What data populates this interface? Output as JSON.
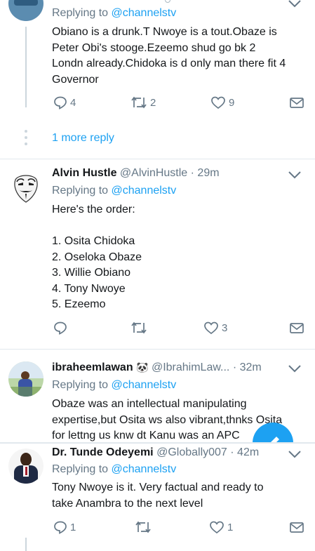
{
  "replying_prefix": "Replying to",
  "tweet1": {
    "replying_to": "@channelstv",
    "text": "Obiano is a drunk.T Nwoye is a tout.Obaze is\nPeter Obi's stooge.Ezeemo shud go bk 2\nLondn already.Chidoka is d only man there fit 4\nGovernor",
    "reply_count": "4",
    "retweet_count": "2",
    "like_count": "9",
    "more_replies": "1 more reply"
  },
  "tweet2": {
    "name": "Alvin Hustle",
    "handle": "@AlvinHustle · 29m",
    "replying_to": "@channelstv",
    "text": "Here's the order:\n\n1. Osita Chidoka\n2. Oseloka Obaze\n3. Willie Obiano\n4. Tony Nwoye\n5. Ezeemo",
    "reply_count": "",
    "retweet_count": "",
    "like_count": "3"
  },
  "tweet3": {
    "name": "ibraheemlawan",
    "emoji": "🐼",
    "handle": "@IbrahimLaw...",
    "time": "· 32m",
    "replying_to": "@channelstv",
    "text": "Obaze was an intellectual manipulating\nexpertise,but Osita ws also vibrant,thnks Osita\nfor lettng us knw dt Kanu was an APC         st"
  },
  "tweet4": {
    "name": "Dr. Tunde Odeyemi",
    "handle": "@Globally007 · 42m",
    "replying_to": "@channelstv",
    "text": "Tony Nwoye is it. Very factual and ready to\ntake Anambra to the next level",
    "reply_count": "1",
    "retweet_count": "",
    "like_count": "1"
  },
  "colors": {
    "link": "#1da1f2",
    "muted": "#657786",
    "divider": "#e1e8ed",
    "fab": "#1da1f2"
  },
  "icons": [
    "reply-icon",
    "retweet-icon",
    "like-icon",
    "message-icon",
    "chevron-down-icon",
    "compose-fab-icon"
  ]
}
